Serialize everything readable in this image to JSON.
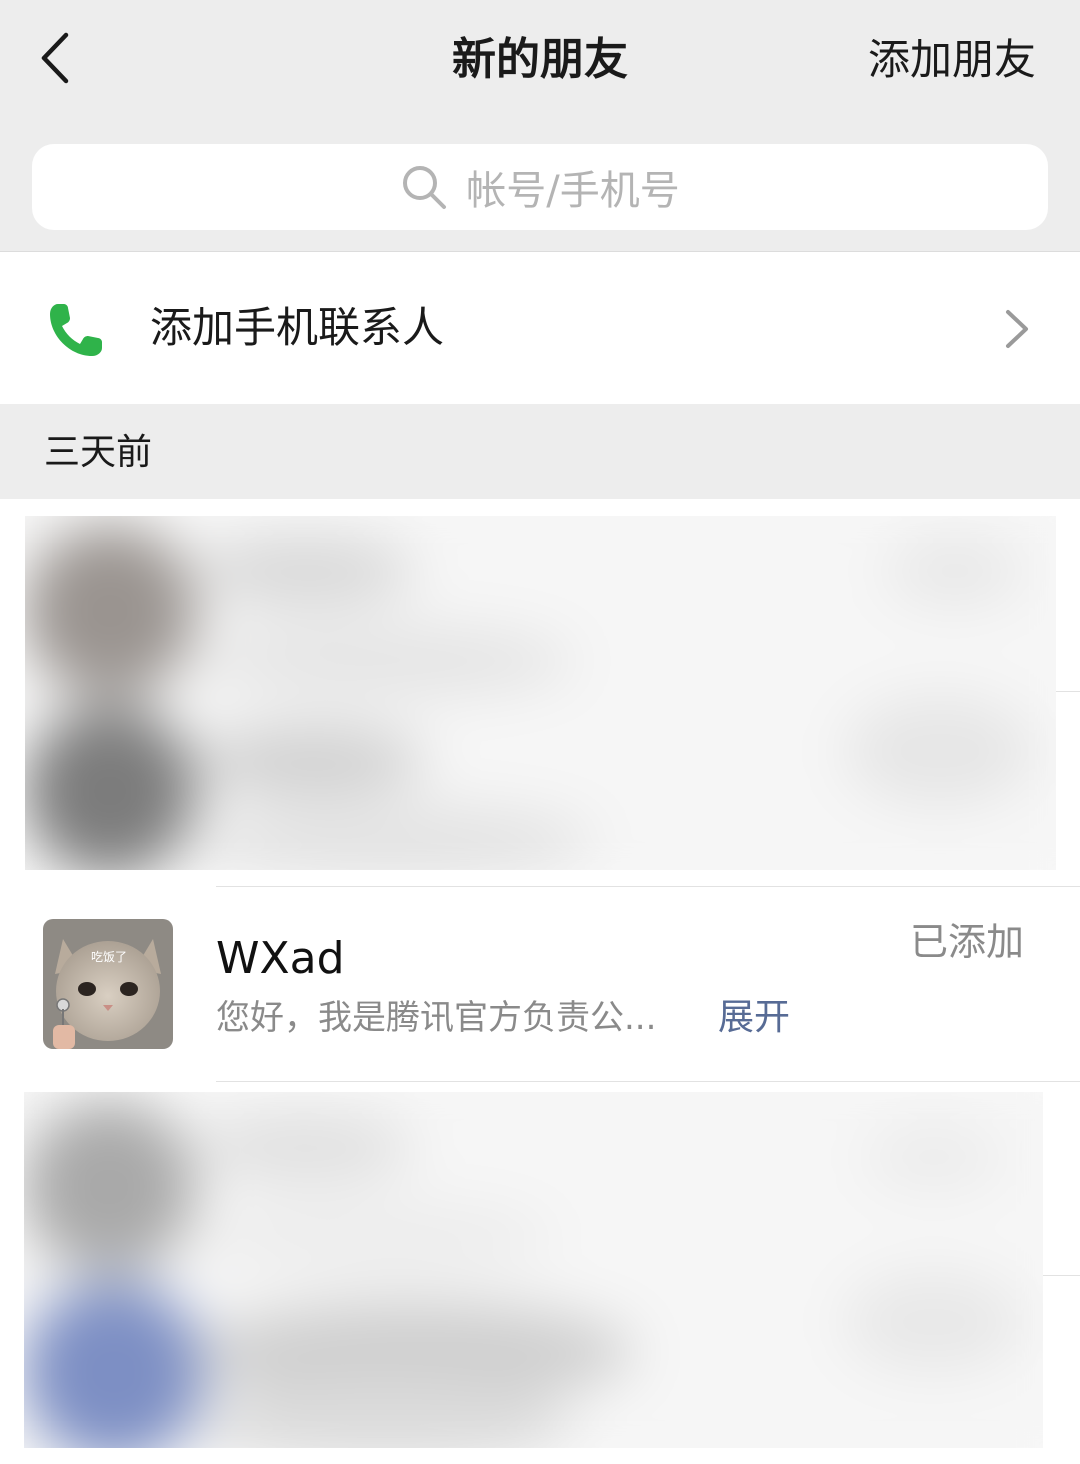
{
  "header": {
    "title": "新的朋友",
    "add_friend_label": "添加朋友"
  },
  "search": {
    "placeholder": "帐号/手机号"
  },
  "phone_contacts": {
    "label": "添加手机联系人",
    "icon": "phone-icon",
    "accent": "#2fb34a"
  },
  "section": {
    "label": "三天前"
  },
  "friend": {
    "name": "WXad",
    "message": "您好，我是腾讯官方负责公...",
    "expand_label": "展开",
    "status": "已添加",
    "avatar_caption": "吃饭了"
  },
  "colors": {
    "header_bg": "#ededed",
    "link": "#576b95",
    "secondary_text": "#8a8a8a"
  }
}
